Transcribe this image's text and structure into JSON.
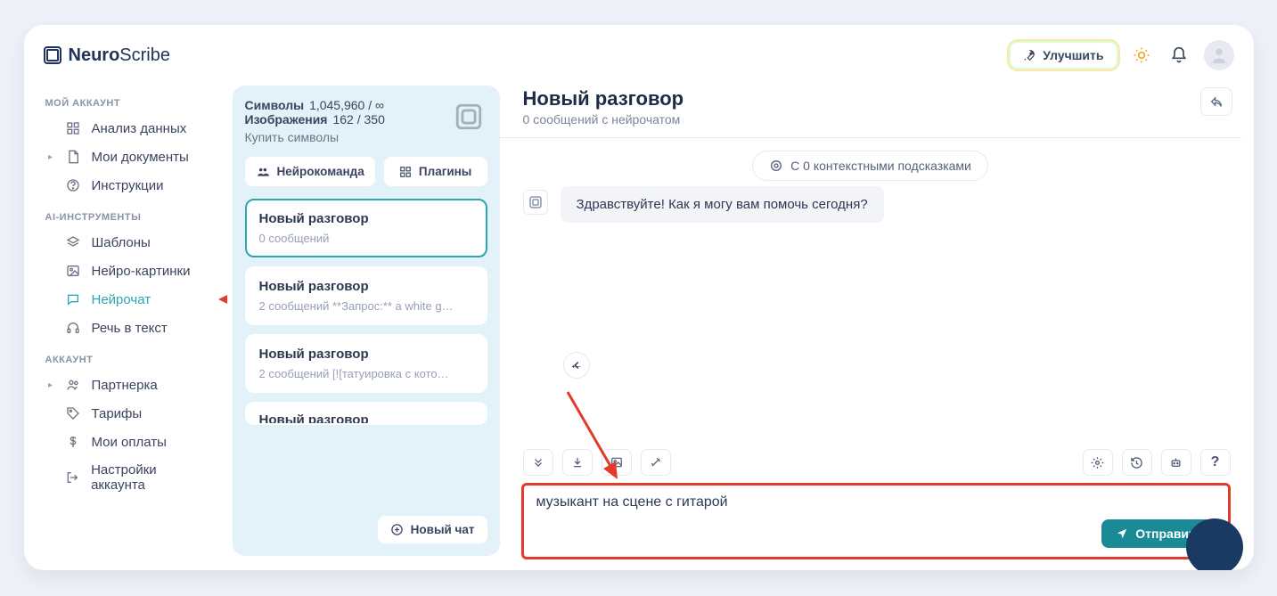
{
  "brand": {
    "name_bold": "Neuro",
    "name_light": "Scribe"
  },
  "header": {
    "upgrade": "Улучшить"
  },
  "sidebar": {
    "section1_title": "МОЙ АККАУНТ",
    "links1": [
      {
        "label": "Анализ данных"
      },
      {
        "label": "Мои документы"
      },
      {
        "label": "Инструкции"
      }
    ],
    "section2_title": "AI-ИНСТРУМЕНТЫ",
    "links2": [
      {
        "label": "Шаблоны"
      },
      {
        "label": "Нейро-картинки"
      },
      {
        "label": "Нейрочат"
      },
      {
        "label": "Речь в текст"
      }
    ],
    "section3_title": "АККАУНТ",
    "links3": [
      {
        "label": "Партнерка"
      },
      {
        "label": "Тарифы"
      },
      {
        "label": "Мои оплаты"
      },
      {
        "label": "Настройки аккаунта"
      }
    ]
  },
  "chatcol": {
    "symbols_label": "Символы",
    "symbols_value": "1,045,960 / ∞",
    "images_label": "Изображения",
    "images_value": "162 / 350",
    "buy": "Купить символы",
    "pill_team": "Нейрокоманда",
    "pill_plugins": "Плагины",
    "newchat": "Новый чат",
    "items": [
      {
        "title": "Новый разговор",
        "sub": "0 сообщений"
      },
      {
        "title": "Новый разговор",
        "sub": "2 сообщений   **Запрос:** a white g…"
      },
      {
        "title": "Новый разговор",
        "sub": "2 сообщений   [![татуировка с кото…"
      },
      {
        "title": "Новый разговор",
        "sub": ""
      }
    ]
  },
  "main": {
    "title": "Новый разговор",
    "subtitle": "0 сообщений с нейрочатом",
    "context": "С 0 контекстными подсказками",
    "bot_greeting": "Здравствуйте! Как я могу вам помочь сегодня?",
    "input_value": "музыкант на сцене с гитарой",
    "send": "Отправить"
  }
}
